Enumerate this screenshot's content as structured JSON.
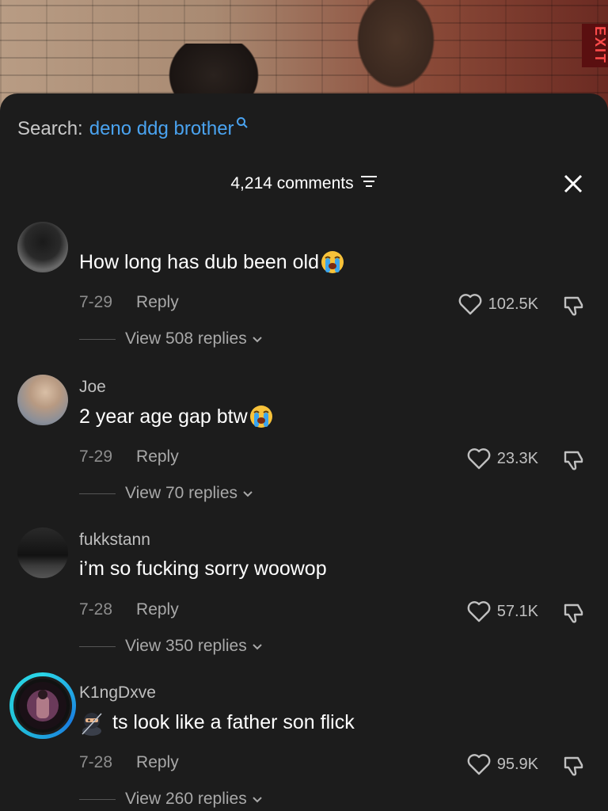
{
  "background": {
    "exit_sign": "EXIT"
  },
  "search": {
    "label": "Search:",
    "query": "deno ddg brother",
    "icon": "search-icon"
  },
  "header": {
    "count_label": "4,214 comments",
    "filter_icon": "filter-icon",
    "close_icon": "close-icon"
  },
  "comments": [
    {
      "username": "",
      "text": "How long has dub been old",
      "emoji": "loudly-crying-face",
      "date": "7-29",
      "reply_label": "Reply",
      "likes": "102.5K",
      "view_replies": "View 508 replies"
    },
    {
      "username": "Joe",
      "text": "2 year age gap btw",
      "emoji": "loudly-crying-face",
      "date": "7-29",
      "reply_label": "Reply",
      "likes": "23.3K",
      "view_replies": "View 70 replies"
    },
    {
      "username": "fukkstann",
      "text": "i’m so fucking sorry woowop",
      "emoji": "",
      "date": "7-28",
      "reply_label": "Reply",
      "likes": "57.1K",
      "view_replies": "View 350 replies"
    },
    {
      "username": "K1ngDxve",
      "text": "ts look like a father son flick",
      "emoji": "ninja",
      "date": "7-28",
      "reply_label": "Reply",
      "likes": "95.9K",
      "view_replies": "View 260 replies"
    }
  ],
  "colors": {
    "sheet_bg": "#1c1c1c",
    "accent_link": "#4aa3f0",
    "story_ring": "#2ad6e8"
  }
}
